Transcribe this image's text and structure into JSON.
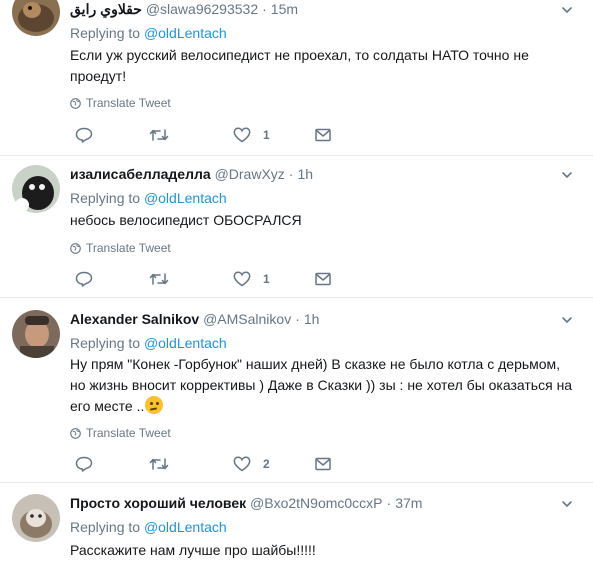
{
  "colors": {
    "link": "#1b95e0",
    "muted": "#657786",
    "text": "#14171a",
    "divider": "#e6ecf0"
  },
  "tweets": [
    {
      "name": "حقلاوي رايق",
      "handle": "@slawa96293532",
      "time": "15m",
      "reply_prefix": "Replying to",
      "reply_to": "@oldLentach",
      "text": "Если уж русский велосипедист не проехал, то солдаты НАТО точно не проедут!",
      "translate": "Translate Tweet",
      "likes": "1"
    },
    {
      "name": "изалисабелладелла",
      "handle": "@DrawXyz",
      "time": "1h",
      "reply_prefix": "Replying to",
      "reply_to": "@oldLentach",
      "text": "небось велосипедист ОБОСРАЛСЯ",
      "translate": "Translate Tweet",
      "likes": "1"
    },
    {
      "name": "Alexander Salnikov",
      "handle": "@AMSalnikov",
      "time": "1h",
      "reply_prefix": "Replying to",
      "reply_to": "@oldLentach",
      "text": "Ну прям \"Конек -Горбунок\" наших дней) В сказке не было котла с дерьмом, но жизнь вносит коррективы ) Даже в Сказки )) зы : не хотел бы оказаться на его месте ..",
      "translate": "Translate Tweet",
      "likes": "2"
    },
    {
      "name": "Просто хороший человек",
      "handle": "@Bxo2tN9omc0ccxP",
      "time": "37m",
      "reply_prefix": "Replying to",
      "reply_to": "@oldLentach",
      "text": "Расскажите нам лучше про шайбы!!!!!"
    }
  ],
  "sep": "·",
  "icons": [
    "reply-icon",
    "retweet-icon",
    "like-icon",
    "message-icon",
    "globe-icon",
    "chevron-down-icon",
    "thinking-face-emoji"
  ]
}
